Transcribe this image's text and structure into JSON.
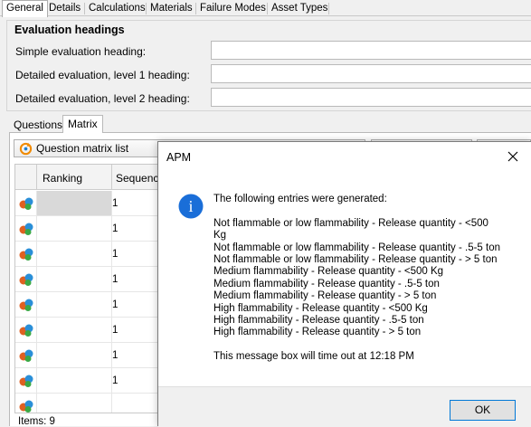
{
  "top_tabs": [
    "General",
    "Details",
    "Calculations",
    "Materials",
    "Failure Modes",
    "Asset Types"
  ],
  "evaluation_headings": {
    "title": "Evaluation headings",
    "simple_label": "Simple evaluation  heading:",
    "detailed_1_label": "Detailed evaluation, level 1 heading:",
    "detailed_2_label": "Detailed evaluation, level 2 heading:",
    "simple_value": "",
    "detailed_1_value": "",
    "detailed_2_value": ""
  },
  "inner_tabs": [
    "Questions",
    "Matrix"
  ],
  "matrix_toolbar": {
    "list_label": "Question matrix list"
  },
  "grid": {
    "columns": [
      "Ranking",
      "Sequence"
    ],
    "rows": [
      {
        "ranking": "",
        "sequence": "1"
      },
      {
        "ranking": "",
        "sequence": "1"
      },
      {
        "ranking": "",
        "sequence": "1"
      },
      {
        "ranking": "",
        "sequence": "1"
      },
      {
        "ranking": "",
        "sequence": "1"
      },
      {
        "ranking": "",
        "sequence": "1"
      },
      {
        "ranking": "",
        "sequence": "1"
      },
      {
        "ranking": "",
        "sequence": "1"
      },
      {
        "ranking": "",
        "sequence": ""
      }
    ],
    "items_label": "Items: 9"
  },
  "dialog": {
    "title": "APM",
    "intro": "The following entries were generated:",
    "entries": [
      "Not flammable or low flammability - Release quantity - <500 Kg",
      "Not flammable or low flammability - Release quantity - .5-5 ton",
      "Not flammable or low flammability - Release quantity - > 5 ton",
      "Medium flammability - Release quantity - <500 Kg",
      "Medium flammability - Release quantity - .5-5 ton",
      "Medium flammability - Release quantity - > 5 ton",
      "High flammability - Release quantity - <500 Kg",
      "High flammability - Release quantity - .5-5 ton",
      "High flammability - Release quantity - > 5 ton"
    ],
    "timeout_message": "This message box will time out at 12:18 PM",
    "ok_label": "OK",
    "info_glyph": "i"
  }
}
